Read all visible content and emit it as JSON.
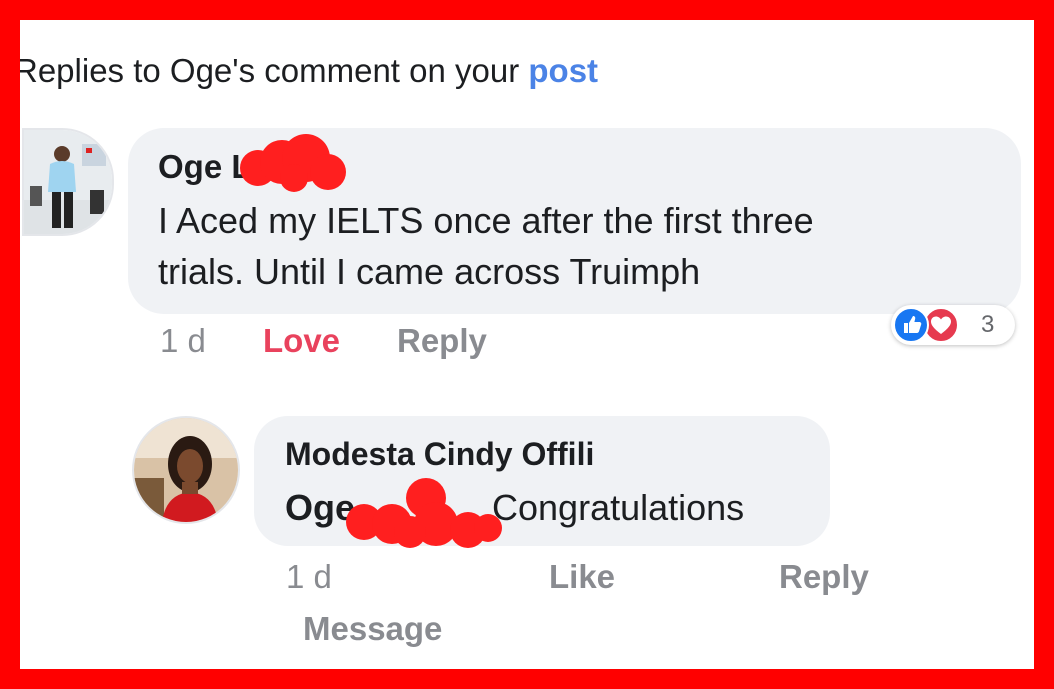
{
  "header": {
    "prefix": "Replies to Oge's comment on your ",
    "link": "post"
  },
  "comment": {
    "author": "Oge L",
    "line1": "I Aced my IELTS once after the first three",
    "line2": "trials. Until I came across Truimph",
    "time": "1 d",
    "love_label": "Love",
    "reply_label": "Reply",
    "reaction_count": "3",
    "reactions": [
      "like-icon",
      "heart-icon"
    ]
  },
  "reply": {
    "author": "Modesta Cindy Offili",
    "mention": "Oge",
    "text": "Congratulations",
    "time": "1 d",
    "like_label": "Like",
    "reply_label": "Reply",
    "message_label": "Message"
  },
  "colors": {
    "frame": "#ff0000",
    "link": "#4b83e6",
    "love": "#e9425d",
    "redaction": "#ff1f1f",
    "bubble": "#f0f2f5"
  }
}
